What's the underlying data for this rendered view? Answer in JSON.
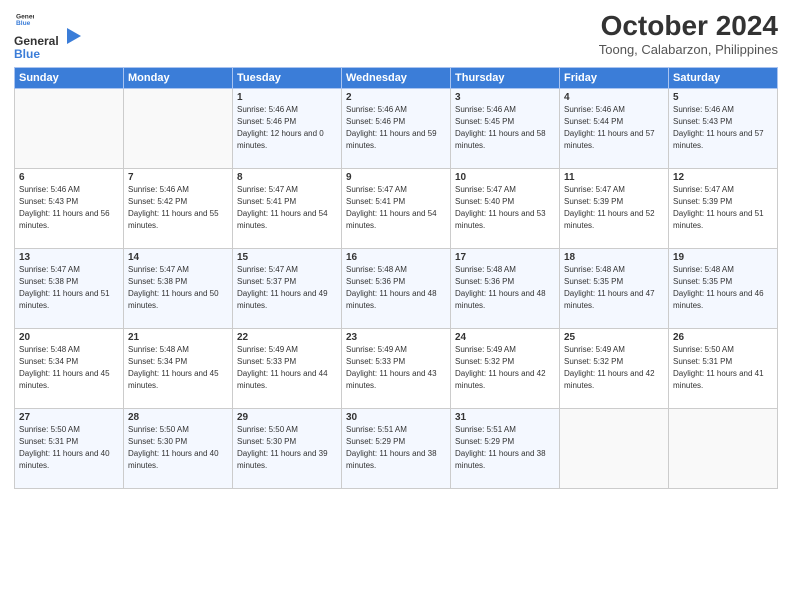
{
  "logo": {
    "line1": "General",
    "line2": "Blue"
  },
  "title": "October 2024",
  "subtitle": "Toong, Calabarzon, Philippines",
  "headers": [
    "Sunday",
    "Monday",
    "Tuesday",
    "Wednesday",
    "Thursday",
    "Friday",
    "Saturday"
  ],
  "weeks": [
    [
      {
        "day": "",
        "sunrise": "",
        "sunset": "",
        "daylight": ""
      },
      {
        "day": "",
        "sunrise": "",
        "sunset": "",
        "daylight": ""
      },
      {
        "day": "1",
        "sunrise": "Sunrise: 5:46 AM",
        "sunset": "Sunset: 5:46 PM",
        "daylight": "Daylight: 12 hours and 0 minutes."
      },
      {
        "day": "2",
        "sunrise": "Sunrise: 5:46 AM",
        "sunset": "Sunset: 5:46 PM",
        "daylight": "Daylight: 11 hours and 59 minutes."
      },
      {
        "day": "3",
        "sunrise": "Sunrise: 5:46 AM",
        "sunset": "Sunset: 5:45 PM",
        "daylight": "Daylight: 11 hours and 58 minutes."
      },
      {
        "day": "4",
        "sunrise": "Sunrise: 5:46 AM",
        "sunset": "Sunset: 5:44 PM",
        "daylight": "Daylight: 11 hours and 57 minutes."
      },
      {
        "day": "5",
        "sunrise": "Sunrise: 5:46 AM",
        "sunset": "Sunset: 5:43 PM",
        "daylight": "Daylight: 11 hours and 57 minutes."
      }
    ],
    [
      {
        "day": "6",
        "sunrise": "Sunrise: 5:46 AM",
        "sunset": "Sunset: 5:43 PM",
        "daylight": "Daylight: 11 hours and 56 minutes."
      },
      {
        "day": "7",
        "sunrise": "Sunrise: 5:46 AM",
        "sunset": "Sunset: 5:42 PM",
        "daylight": "Daylight: 11 hours and 55 minutes."
      },
      {
        "day": "8",
        "sunrise": "Sunrise: 5:47 AM",
        "sunset": "Sunset: 5:41 PM",
        "daylight": "Daylight: 11 hours and 54 minutes."
      },
      {
        "day": "9",
        "sunrise": "Sunrise: 5:47 AM",
        "sunset": "Sunset: 5:41 PM",
        "daylight": "Daylight: 11 hours and 54 minutes."
      },
      {
        "day": "10",
        "sunrise": "Sunrise: 5:47 AM",
        "sunset": "Sunset: 5:40 PM",
        "daylight": "Daylight: 11 hours and 53 minutes."
      },
      {
        "day": "11",
        "sunrise": "Sunrise: 5:47 AM",
        "sunset": "Sunset: 5:39 PM",
        "daylight": "Daylight: 11 hours and 52 minutes."
      },
      {
        "day": "12",
        "sunrise": "Sunrise: 5:47 AM",
        "sunset": "Sunset: 5:39 PM",
        "daylight": "Daylight: 11 hours and 51 minutes."
      }
    ],
    [
      {
        "day": "13",
        "sunrise": "Sunrise: 5:47 AM",
        "sunset": "Sunset: 5:38 PM",
        "daylight": "Daylight: 11 hours and 51 minutes."
      },
      {
        "day": "14",
        "sunrise": "Sunrise: 5:47 AM",
        "sunset": "Sunset: 5:38 PM",
        "daylight": "Daylight: 11 hours and 50 minutes."
      },
      {
        "day": "15",
        "sunrise": "Sunrise: 5:47 AM",
        "sunset": "Sunset: 5:37 PM",
        "daylight": "Daylight: 11 hours and 49 minutes."
      },
      {
        "day": "16",
        "sunrise": "Sunrise: 5:48 AM",
        "sunset": "Sunset: 5:36 PM",
        "daylight": "Daylight: 11 hours and 48 minutes."
      },
      {
        "day": "17",
        "sunrise": "Sunrise: 5:48 AM",
        "sunset": "Sunset: 5:36 PM",
        "daylight": "Daylight: 11 hours and 48 minutes."
      },
      {
        "day": "18",
        "sunrise": "Sunrise: 5:48 AM",
        "sunset": "Sunset: 5:35 PM",
        "daylight": "Daylight: 11 hours and 47 minutes."
      },
      {
        "day": "19",
        "sunrise": "Sunrise: 5:48 AM",
        "sunset": "Sunset: 5:35 PM",
        "daylight": "Daylight: 11 hours and 46 minutes."
      }
    ],
    [
      {
        "day": "20",
        "sunrise": "Sunrise: 5:48 AM",
        "sunset": "Sunset: 5:34 PM",
        "daylight": "Daylight: 11 hours and 45 minutes."
      },
      {
        "day": "21",
        "sunrise": "Sunrise: 5:48 AM",
        "sunset": "Sunset: 5:34 PM",
        "daylight": "Daylight: 11 hours and 45 minutes."
      },
      {
        "day": "22",
        "sunrise": "Sunrise: 5:49 AM",
        "sunset": "Sunset: 5:33 PM",
        "daylight": "Daylight: 11 hours and 44 minutes."
      },
      {
        "day": "23",
        "sunrise": "Sunrise: 5:49 AM",
        "sunset": "Sunset: 5:33 PM",
        "daylight": "Daylight: 11 hours and 43 minutes."
      },
      {
        "day": "24",
        "sunrise": "Sunrise: 5:49 AM",
        "sunset": "Sunset: 5:32 PM",
        "daylight": "Daylight: 11 hours and 42 minutes."
      },
      {
        "day": "25",
        "sunrise": "Sunrise: 5:49 AM",
        "sunset": "Sunset: 5:32 PM",
        "daylight": "Daylight: 11 hours and 42 minutes."
      },
      {
        "day": "26",
        "sunrise": "Sunrise: 5:50 AM",
        "sunset": "Sunset: 5:31 PM",
        "daylight": "Daylight: 11 hours and 41 minutes."
      }
    ],
    [
      {
        "day": "27",
        "sunrise": "Sunrise: 5:50 AM",
        "sunset": "Sunset: 5:31 PM",
        "daylight": "Daylight: 11 hours and 40 minutes."
      },
      {
        "day": "28",
        "sunrise": "Sunrise: 5:50 AM",
        "sunset": "Sunset: 5:30 PM",
        "daylight": "Daylight: 11 hours and 40 minutes."
      },
      {
        "day": "29",
        "sunrise": "Sunrise: 5:50 AM",
        "sunset": "Sunset: 5:30 PM",
        "daylight": "Daylight: 11 hours and 39 minutes."
      },
      {
        "day": "30",
        "sunrise": "Sunrise: 5:51 AM",
        "sunset": "Sunset: 5:29 PM",
        "daylight": "Daylight: 11 hours and 38 minutes."
      },
      {
        "day": "31",
        "sunrise": "Sunrise: 5:51 AM",
        "sunset": "Sunset: 5:29 PM",
        "daylight": "Daylight: 11 hours and 38 minutes."
      },
      {
        "day": "",
        "sunrise": "",
        "sunset": "",
        "daylight": ""
      },
      {
        "day": "",
        "sunrise": "",
        "sunset": "",
        "daylight": ""
      }
    ]
  ]
}
